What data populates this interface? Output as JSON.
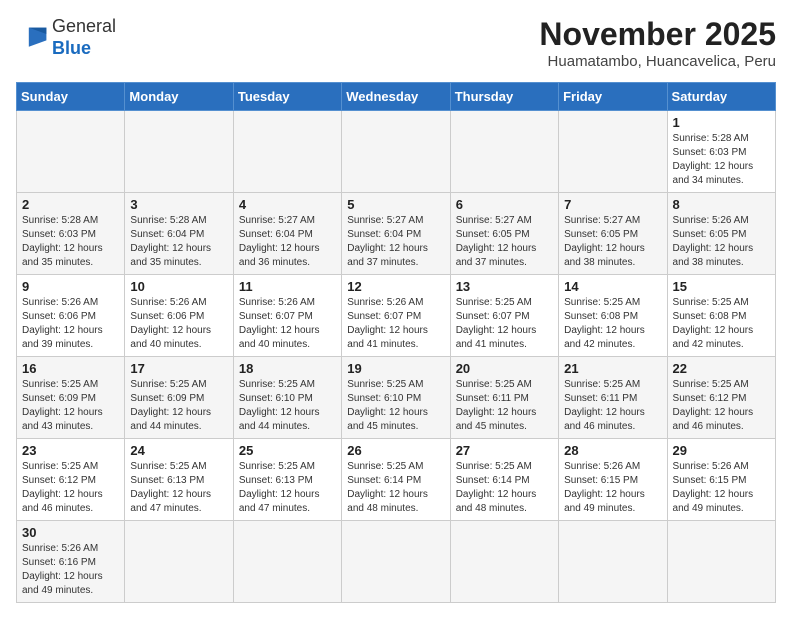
{
  "header": {
    "logo_general": "General",
    "logo_blue": "Blue",
    "month_year": "November 2025",
    "location": "Huamatambo, Huancavelica, Peru"
  },
  "weekdays": [
    "Sunday",
    "Monday",
    "Tuesday",
    "Wednesday",
    "Thursday",
    "Friday",
    "Saturday"
  ],
  "weeks": [
    [
      {
        "day": "",
        "info": ""
      },
      {
        "day": "",
        "info": ""
      },
      {
        "day": "",
        "info": ""
      },
      {
        "day": "",
        "info": ""
      },
      {
        "day": "",
        "info": ""
      },
      {
        "day": "",
        "info": ""
      },
      {
        "day": "1",
        "info": "Sunrise: 5:28 AM\nSunset: 6:03 PM\nDaylight: 12 hours and 34 minutes."
      }
    ],
    [
      {
        "day": "2",
        "info": "Sunrise: 5:28 AM\nSunset: 6:03 PM\nDaylight: 12 hours and 35 minutes."
      },
      {
        "day": "3",
        "info": "Sunrise: 5:28 AM\nSunset: 6:04 PM\nDaylight: 12 hours and 35 minutes."
      },
      {
        "day": "4",
        "info": "Sunrise: 5:27 AM\nSunset: 6:04 PM\nDaylight: 12 hours and 36 minutes."
      },
      {
        "day": "5",
        "info": "Sunrise: 5:27 AM\nSunset: 6:04 PM\nDaylight: 12 hours and 37 minutes."
      },
      {
        "day": "6",
        "info": "Sunrise: 5:27 AM\nSunset: 6:05 PM\nDaylight: 12 hours and 37 minutes."
      },
      {
        "day": "7",
        "info": "Sunrise: 5:27 AM\nSunset: 6:05 PM\nDaylight: 12 hours and 38 minutes."
      },
      {
        "day": "8",
        "info": "Sunrise: 5:26 AM\nSunset: 6:05 PM\nDaylight: 12 hours and 38 minutes."
      }
    ],
    [
      {
        "day": "9",
        "info": "Sunrise: 5:26 AM\nSunset: 6:06 PM\nDaylight: 12 hours and 39 minutes."
      },
      {
        "day": "10",
        "info": "Sunrise: 5:26 AM\nSunset: 6:06 PM\nDaylight: 12 hours and 40 minutes."
      },
      {
        "day": "11",
        "info": "Sunrise: 5:26 AM\nSunset: 6:07 PM\nDaylight: 12 hours and 40 minutes."
      },
      {
        "day": "12",
        "info": "Sunrise: 5:26 AM\nSunset: 6:07 PM\nDaylight: 12 hours and 41 minutes."
      },
      {
        "day": "13",
        "info": "Sunrise: 5:25 AM\nSunset: 6:07 PM\nDaylight: 12 hours and 41 minutes."
      },
      {
        "day": "14",
        "info": "Sunrise: 5:25 AM\nSunset: 6:08 PM\nDaylight: 12 hours and 42 minutes."
      },
      {
        "day": "15",
        "info": "Sunrise: 5:25 AM\nSunset: 6:08 PM\nDaylight: 12 hours and 42 minutes."
      }
    ],
    [
      {
        "day": "16",
        "info": "Sunrise: 5:25 AM\nSunset: 6:09 PM\nDaylight: 12 hours and 43 minutes."
      },
      {
        "day": "17",
        "info": "Sunrise: 5:25 AM\nSunset: 6:09 PM\nDaylight: 12 hours and 44 minutes."
      },
      {
        "day": "18",
        "info": "Sunrise: 5:25 AM\nSunset: 6:10 PM\nDaylight: 12 hours and 44 minutes."
      },
      {
        "day": "19",
        "info": "Sunrise: 5:25 AM\nSunset: 6:10 PM\nDaylight: 12 hours and 45 minutes."
      },
      {
        "day": "20",
        "info": "Sunrise: 5:25 AM\nSunset: 6:11 PM\nDaylight: 12 hours and 45 minutes."
      },
      {
        "day": "21",
        "info": "Sunrise: 5:25 AM\nSunset: 6:11 PM\nDaylight: 12 hours and 46 minutes."
      },
      {
        "day": "22",
        "info": "Sunrise: 5:25 AM\nSunset: 6:12 PM\nDaylight: 12 hours and 46 minutes."
      }
    ],
    [
      {
        "day": "23",
        "info": "Sunrise: 5:25 AM\nSunset: 6:12 PM\nDaylight: 12 hours and 46 minutes."
      },
      {
        "day": "24",
        "info": "Sunrise: 5:25 AM\nSunset: 6:13 PM\nDaylight: 12 hours and 47 minutes."
      },
      {
        "day": "25",
        "info": "Sunrise: 5:25 AM\nSunset: 6:13 PM\nDaylight: 12 hours and 47 minutes."
      },
      {
        "day": "26",
        "info": "Sunrise: 5:25 AM\nSunset: 6:14 PM\nDaylight: 12 hours and 48 minutes."
      },
      {
        "day": "27",
        "info": "Sunrise: 5:25 AM\nSunset: 6:14 PM\nDaylight: 12 hours and 48 minutes."
      },
      {
        "day": "28",
        "info": "Sunrise: 5:26 AM\nSunset: 6:15 PM\nDaylight: 12 hours and 49 minutes."
      },
      {
        "day": "29",
        "info": "Sunrise: 5:26 AM\nSunset: 6:15 PM\nDaylight: 12 hours and 49 minutes."
      }
    ],
    [
      {
        "day": "30",
        "info": "Sunrise: 5:26 AM\nSunset: 6:16 PM\nDaylight: 12 hours and 49 minutes."
      },
      {
        "day": "",
        "info": ""
      },
      {
        "day": "",
        "info": ""
      },
      {
        "day": "",
        "info": ""
      },
      {
        "day": "",
        "info": ""
      },
      {
        "day": "",
        "info": ""
      },
      {
        "day": "",
        "info": ""
      }
    ]
  ]
}
